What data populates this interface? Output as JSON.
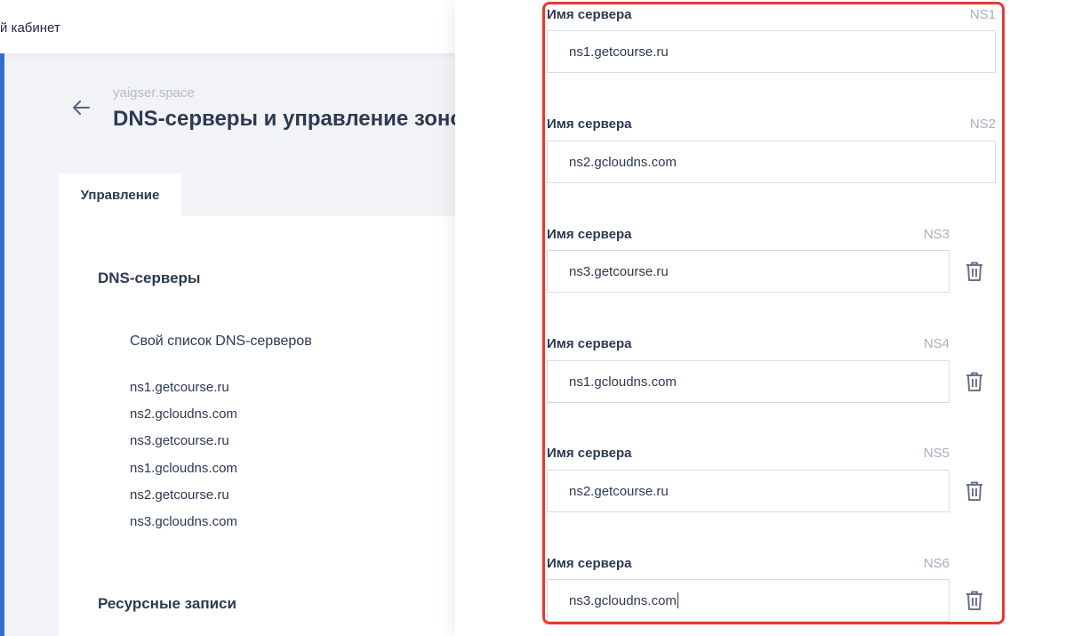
{
  "topbar": {
    "title": "й кабинет"
  },
  "header": {
    "domain": "yaigser.space",
    "title": "DNS-серверы и управление зоной"
  },
  "tabs": [
    {
      "label": "Управление"
    }
  ],
  "main": {
    "dns_section_title": "DNS-серверы",
    "own_list_label": "Свой список DNS-серверов",
    "ns_list": [
      "ns1.getcourse.ru",
      "ns2.gcloudns.com",
      "ns3.getcourse.ru",
      "ns1.gcloudns.com",
      "ns2.getcourse.ru",
      "ns3.gcloudns.com"
    ],
    "resource_section_title": "Ресурсные записи"
  },
  "drawer": {
    "fields": [
      {
        "label": "Имя сервера",
        "tag": "NS1",
        "value": "ns1.getcourse.ru",
        "deletable": false
      },
      {
        "label": "Имя сервера",
        "tag": "NS2",
        "value": "ns2.gcloudns.com",
        "deletable": false
      },
      {
        "label": "Имя сервера",
        "tag": "NS3",
        "value": "ns3.getcourse.ru",
        "deletable": true
      },
      {
        "label": "Имя сервера",
        "tag": "NS4",
        "value": "ns1.gcloudns.com",
        "deletable": true
      },
      {
        "label": "Имя сервера",
        "tag": "NS5",
        "value": "ns2.getcourse.ru",
        "deletable": true
      },
      {
        "label": "Имя сервера",
        "tag": "NS6",
        "value": "ns3.gcloudns.com",
        "deletable": true
      }
    ]
  },
  "colors": {
    "accent": "#2f6fd1",
    "highlight_border": "#e33b30",
    "text": "#2d3a52",
    "muted": "#a8afbd"
  }
}
